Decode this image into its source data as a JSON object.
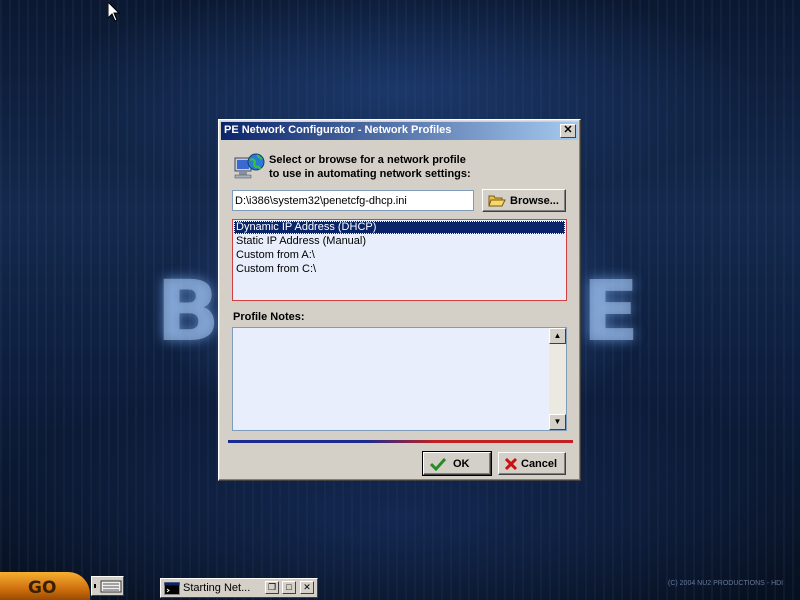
{
  "dialog": {
    "title": "PE Network Configurator - Network Profiles",
    "header_line1": "Select or browse for a network profile",
    "header_line2": "to use in automating network settings:",
    "path_value": "D:\\i386\\system32\\penetcfg-dhcp.ini",
    "browse_label": "Browse...",
    "profiles": [
      {
        "label": "Dynamic IP Address (DHCP)",
        "selected": true
      },
      {
        "label": "Static IP Address (Manual)",
        "selected": false
      },
      {
        "label": "Custom from A:\\",
        "selected": false
      },
      {
        "label": "Custom from C:\\",
        "selected": false
      }
    ],
    "notes_label": "Profile Notes:",
    "notes_value": "",
    "ok_label": "OK",
    "cancel_label": "Cancel"
  },
  "taskbar": {
    "go_label": "GO",
    "task_label": "Starting Net...",
    "copyright": "(C) 2004 NU2 PRODUCTIONS - HDI"
  },
  "colors": {
    "title_gradient_start": "#0a246a",
    "title_gradient_end": "#a6caf0",
    "selection": "#0a246a",
    "list_border": "#d04040",
    "ok_check": "#2a8a2a",
    "cancel_x": "#cc1010"
  },
  "icons": {
    "header": "network-computer-globe-icon",
    "browse": "open-folder-icon",
    "ok": "checkmark-icon",
    "cancel": "red-x-icon",
    "close": "close-icon",
    "task": "command-prompt-icon"
  }
}
